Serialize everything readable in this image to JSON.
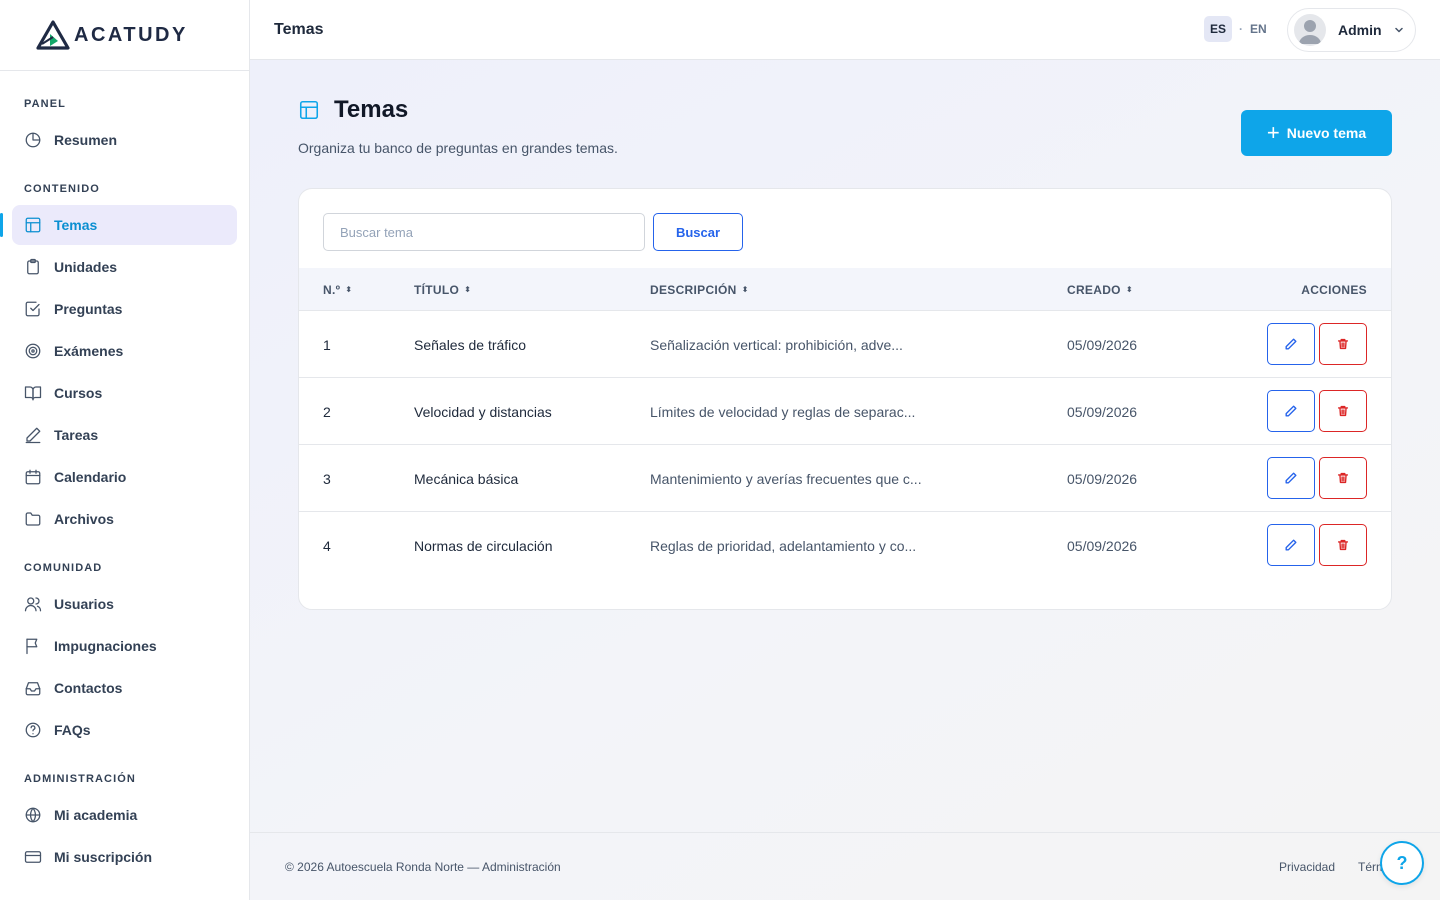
{
  "brand": {
    "logo_text": "ACATUDY"
  },
  "sidebar": {
    "sections": [
      {
        "title": "PANEL",
        "items": [
          {
            "label": "Resumen",
            "icon": "pie-chart-icon"
          }
        ]
      },
      {
        "title": "CONTENIDO",
        "items": [
          {
            "label": "Temas",
            "icon": "layout-icon",
            "active": true
          },
          {
            "label": "Unidades",
            "icon": "clipboard-icon"
          },
          {
            "label": "Preguntas",
            "icon": "check-square-icon"
          },
          {
            "label": "Exámenes",
            "icon": "target-icon"
          },
          {
            "label": "Cursos",
            "icon": "book-open-icon"
          },
          {
            "label": "Tareas",
            "icon": "pen-icon"
          },
          {
            "label": "Calendario",
            "icon": "calendar-icon"
          },
          {
            "label": "Archivos",
            "icon": "folder-icon"
          }
        ]
      },
      {
        "title": "COMUNIDAD",
        "items": [
          {
            "label": "Usuarios",
            "icon": "users-icon"
          },
          {
            "label": "Impugnaciones",
            "icon": "flag-icon"
          },
          {
            "label": "Contactos",
            "icon": "inbox-icon"
          },
          {
            "label": "FAQs",
            "icon": "help-circle-icon"
          }
        ]
      },
      {
        "title": "ADMINISTRACIÓN",
        "items": [
          {
            "label": "Mi academia",
            "icon": "globe-icon"
          },
          {
            "label": "Mi suscripción",
            "icon": "credit-card-icon"
          }
        ]
      }
    ]
  },
  "topbar": {
    "title": "Temas",
    "lang_es": "ES",
    "lang_sep": "·",
    "lang_en": "EN",
    "user": "Admin"
  },
  "page": {
    "title": "Temas",
    "subtitle": "Organiza tu banco de preguntas en grandes temas.",
    "new_button": "Nuevo tema"
  },
  "search": {
    "placeholder": "Buscar tema",
    "value": "",
    "button": "Buscar"
  },
  "table": {
    "columns": [
      "N.º",
      "TÍTULO",
      "DESCRIPCIÓN",
      "CREADO",
      "ACCIONES"
    ],
    "rows": [
      {
        "num": "1",
        "title": "Señales de tráfico",
        "desc": "Señalización vertical: prohibición, adve...",
        "date": "05/09/2026"
      },
      {
        "num": "2",
        "title": "Velocidad y distancias",
        "desc": "Límites de velocidad y reglas de separac...",
        "date": "05/09/2026"
      },
      {
        "num": "3",
        "title": "Mecánica básica",
        "desc": "Mantenimiento y averías frecuentes que c...",
        "date": "05/09/2026"
      },
      {
        "num": "4",
        "title": "Normas de circulación",
        "desc": "Reglas de prioridad, adelantamiento y co...",
        "date": "05/09/2026"
      }
    ]
  },
  "footer": {
    "copyright": "© 2026 Autoescuela Ronda Norte — Administración",
    "privacy": "Privacidad",
    "terms": "Térm",
    "help": "?"
  },
  "colors": {
    "accent": "#0ea5e9",
    "active_bg": "#ebeafb",
    "edit": "#2563eb",
    "delete": "#dc2626"
  }
}
